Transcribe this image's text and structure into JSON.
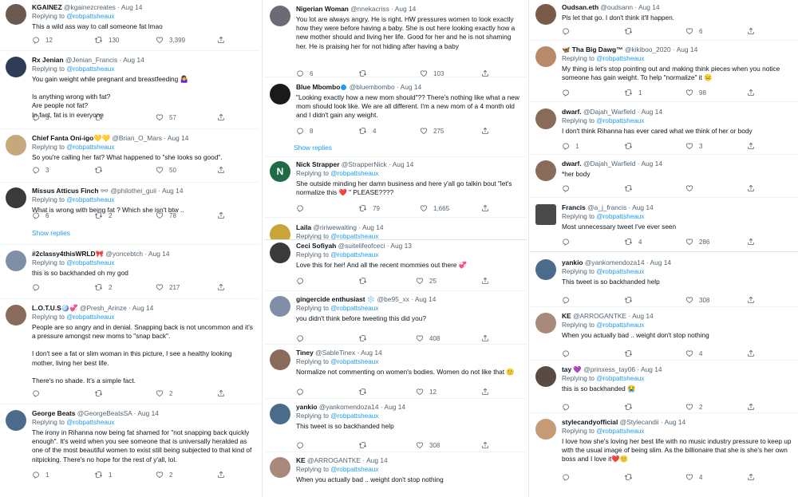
{
  "colors": {
    "link": "#1d9bf0",
    "muted": "#536471",
    "text": "#0f1419",
    "separator": "#eff3f4",
    "verified": "#1d9bf0"
  },
  "icons": [
    "reply-icon",
    "retweet-icon",
    "like-icon",
    "share-icon",
    "verified-badge-icon"
  ],
  "show_replies": "Show replies",
  "reply_prefix": "Replying to",
  "replied_handle": "@robpattsheaux",
  "col1": [
    {
      "name": "KGAINEZ",
      "handle": "@kgainezcreates",
      "date": "Aug 14",
      "text": [
        "This a wild ass way to call someone fat lmao"
      ],
      "counts": {
        "reply": "12",
        "retweet": "130",
        "like": "3,399"
      }
    },
    {
      "name": "Rx Jenian",
      "handle": "@Jenian_Francis",
      "date": "Aug 14",
      "text": [
        "You gain weight while pregnant and breastfeeding 🤷‍♀️",
        "",
        "Is anything wrong with fat?",
        "Are people not fat?",
        "In fact, fat is in everyone"
      ],
      "counts": {
        "reply": "3",
        "retweet": "",
        "like": "57"
      }
    },
    {
      "name": "Chief Fanta Oni-igo💛💛",
      "handle": "@Brian_O_Mars",
      "date": "Aug 14",
      "text": [
        "So you're calling her fat? What happened to \"she looks so good\"."
      ],
      "counts": {
        "reply": "3",
        "retweet": "",
        "like": "50"
      }
    },
    {
      "name": "Missus Atticus Finch 👓",
      "handle": "@philothei_guii",
      "date": "Aug 14",
      "text": [
        "What is wrong with being fat ? Which she isn't btw .."
      ],
      "counts": {
        "reply": "6",
        "retweet": "2",
        "like": "78"
      }
    },
    {
      "name": "#2classy4thisWRLD🎀",
      "handle": "@yoncebtch",
      "date": "Aug 14",
      "text": [
        "this is so backhanded oh my god"
      ],
      "counts": {
        "reply": "",
        "retweet": "2",
        "like": "217"
      }
    },
    {
      "name": "L.O.T.U.S🪩💞",
      "handle": "@Presh_Arinze",
      "date": "Aug 14",
      "text": [
        "People are so angry and in denial. Snapping back is not uncommon and it's a pressure amongst new moms to \"snap back\".",
        "",
        "I don't see a fat or slim woman in this picture, I see a healthy looking mother, living her best life.",
        "",
        "There's no shade. It's a simple fact."
      ],
      "counts": {
        "reply": "",
        "retweet": "",
        "like": "2"
      }
    },
    {
      "name": "George Beats",
      "handle": "@GeorgeBeatsSA",
      "date": "Aug 14",
      "text": [
        "The irony in Rihanna now being fat shamed for \"not snapping back quickly enough\". It's weird when you see someone that is universally heralded as one of the most beautiful women to exist still being subjected to that kind of nitpicking. There's no hope for the rest of y'all, lol."
      ],
      "counts": {
        "reply": "1",
        "retweet": "1",
        "like": "2"
      }
    }
  ],
  "col2": [
    {
      "name": "Nigerian Woman",
      "handle": "@nnekacriss",
      "date": "Aug 14",
      "text": [
        "You lot are always angry. He is right. HW pressures women to look exactly how they were before having a baby. She is out here looking exactly how a new mother should and living her life. Good for her and he is not shaming her. He is praising her for not hiding after having a baby"
      ],
      "counts": {
        "reply": "6",
        "retweet": "",
        "like": "103"
      }
    },
    {
      "name": "Blue Mbombo",
      "handle": "@bluembombo",
      "date": "Aug 14",
      "text": [
        "\"Looking exactly how a new mom should\"?? There's nothing like what a new mom should look like. We are all different. I'm a new mom of a 4 month old and I didn't gain any weight."
      ],
      "counts": {
        "reply": "8",
        "retweet": "4",
        "like": "275"
      }
    },
    {
      "name": "Nick Strapper",
      "handle": "@StrapperNick",
      "date": "Aug 14",
      "text": [
        "She outside minding her damn business and here y'all go talkin bout \"let's normalize this ❤️ \" PLEASE????"
      ],
      "counts": {
        "reply": "",
        "retweet": "79",
        "like": "1,665"
      }
    },
    {
      "name": "Laila",
      "handle": "@ririwewaiting",
      "date": "Aug 14",
      "text": [],
      "counts": {}
    },
    {
      "name": "Ceci Sofiyah",
      "handle": "@suitelifeofceci",
      "date": "Aug 13",
      "text": [
        "Love this for her! And all the recent mommies out there 💞"
      ],
      "counts": {
        "reply": "",
        "retweet": "",
        "like": "25"
      }
    },
    {
      "name": "gingercide enthusiast ❄️",
      "handle": "@be95_xx",
      "date": "Aug 14",
      "text": [
        "you didn't think before tweeting this did you?"
      ],
      "counts": {
        "reply": "",
        "retweet": "",
        "like": "408"
      }
    },
    {
      "name": "Tiney",
      "handle": "@SableTinex",
      "date": "Aug 14",
      "text": [
        "Normalize not commenting on women's bodies. Women do not like that 🙂"
      ],
      "counts": {
        "reply": "",
        "retweet": "",
        "like": "12"
      }
    },
    {
      "name": "yankio",
      "handle": "@yankomendoza14",
      "date": "Aug 14",
      "text": [
        "This tweet is so backhanded help"
      ],
      "counts": {
        "reply": "",
        "retweet": "",
        "like": "308"
      }
    },
    {
      "name": "KE",
      "handle": "@ARROGANTKE",
      "date": "Aug 14",
      "text": [
        "When you actually bad .. weight don't stop nothing"
      ],
      "counts": {}
    }
  ],
  "col3": [
    {
      "name": "Oudsan.eth",
      "handle": "@oudsann",
      "date": "Aug 14",
      "text": [
        "Pls let that go. I don't think it'll happen."
      ],
      "counts": {
        "reply": "",
        "retweet": "",
        "like": "6"
      }
    },
    {
      "name": "🦋 Tha Big Dawg™",
      "handle": "@kikiboo_2020",
      "date": "Aug 14",
      "text": [
        "My thing is let's stop pointing out and making think pieces when you notice someone has gain weight. To help \"normalize\" it 😑"
      ],
      "counts": {
        "reply": "",
        "retweet": "1",
        "like": "98"
      }
    },
    {
      "name": "dwarf.",
      "handle": "@Dajah_Warfield",
      "date": "Aug 14",
      "text": [
        "I don't think Rihanna has ever cared what we think of her or body"
      ],
      "counts": {
        "reply": "1",
        "retweet": "",
        "like": "3"
      }
    },
    {
      "name": "dwarf.",
      "handle": "@Dajah_Warfield",
      "date": "Aug 14",
      "text": [
        "*her body"
      ],
      "counts": {}
    },
    {
      "name": "Francis",
      "handle": "@a_j_francis",
      "date": "Aug 14",
      "text": [
        "Most unnecessary tweet I've ever seen"
      ],
      "counts": {
        "reply": "",
        "retweet": "4",
        "like": "286"
      }
    },
    {
      "name": "yankio",
      "handle": "@yankomendoza14",
      "date": "Aug 14",
      "text": [
        "This tweet is so backhanded help"
      ],
      "counts": {
        "reply": "",
        "retweet": "",
        "like": "308"
      }
    },
    {
      "name": "KE",
      "handle": "@ARROGANTKE",
      "date": "Aug 14",
      "text": [
        "When you actually bad .. weight don't stop nothing"
      ],
      "counts": {
        "reply": "",
        "retweet": "",
        "like": "4"
      }
    },
    {
      "name": "tay 💜",
      "handle": "@prinxess_tay06",
      "date": "Aug 14",
      "text": [
        "this is so backhanded 😭"
      ],
      "counts": {
        "reply": "",
        "retweet": "",
        "like": "2"
      }
    },
    {
      "name": "stylecandyofficial",
      "handle": "@Stylecandii",
      "date": "Aug 14",
      "text": [
        "I love how she's loving her best life with no music industry pressure to keep up with the usual image of being slim. As the billionaire that she is she's her own boss and I love it❤️🙂"
      ],
      "counts": {
        "reply": "",
        "retweet": "",
        "like": "4"
      }
    }
  ]
}
